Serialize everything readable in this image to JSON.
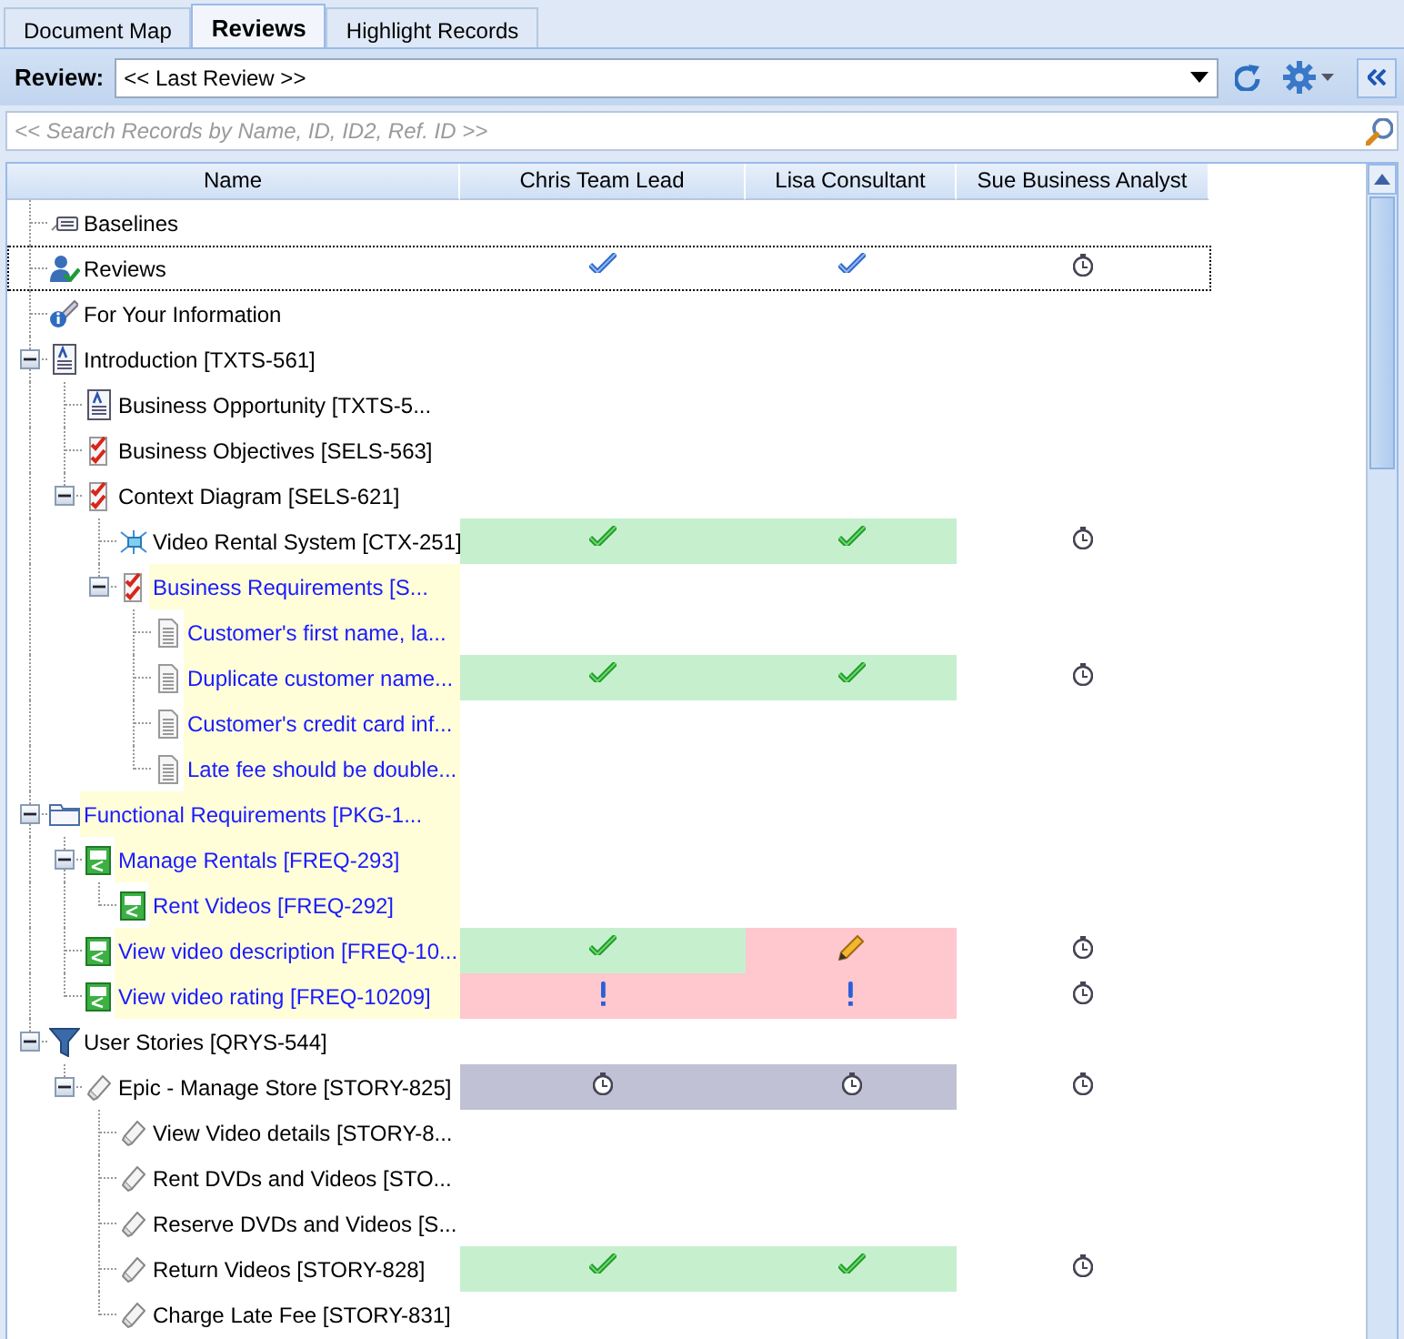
{
  "tabs": [
    {
      "label": "Document Map",
      "selected": false
    },
    {
      "label": "Reviews",
      "selected": true
    },
    {
      "label": "Highlight Records",
      "selected": false
    }
  ],
  "review": {
    "label": "Review:",
    "value": "<< Last Review >>"
  },
  "search": {
    "placeholder": "<< Search Records by Name, ID, ID2, Ref. ID >>"
  },
  "columns": [
    "Name",
    "Chris Team Lead",
    "Lisa Consultant",
    "Sue Business Analyst"
  ],
  "tree": [
    {
      "name": "Baselines",
      "kind": "baseline",
      "selected": false
    },
    {
      "name": "Reviews",
      "kind": "review",
      "selected": true,
      "reviews": [
        {
          "kind": "acknowledged"
        },
        {
          "kind": "acknowledged"
        },
        {
          "kind": "pending"
        }
      ]
    },
    {
      "name": "For Your Information",
      "kind": "info",
      "selected": false
    },
    {
      "name": "Introduction [TXTS-561]",
      "kind": "document",
      "selected": false,
      "expanded": true,
      "children": [
        {
          "name": "Business Opportunity [TXTS-5...",
          "kind": "document",
          "selected": false
        },
        {
          "name": "Business Objectives [SELS-563]",
          "kind": "checklist",
          "selected": false
        },
        {
          "name": "Context Diagram [SELS-621]",
          "kind": "checklist",
          "selected": false,
          "expanded": true,
          "children": [
            {
              "name": "Video Rental System [CTX-251]",
              "kind": "diagram",
              "selected": false,
              "reviews": [
                {
                  "kind": "approved"
                },
                {
                  "kind": "approved"
                },
                {
                  "kind": "pending"
                }
              ]
            },
            {
              "name": "Business Requirements [S...",
              "kind": "checklist",
              "selected": false,
              "link": true,
              "highlighted": true,
              "expanded": true,
              "children": [
                {
                  "name": "Customer's first name, la...",
                  "kind": "text",
                  "selected": false,
                  "link": true,
                  "highlighted": true
                },
                {
                  "name": "Duplicate customer name...",
                  "kind": "text",
                  "selected": false,
                  "link": true,
                  "highlighted": true,
                  "reviews": [
                    {
                      "kind": "approved"
                    },
                    {
                      "kind": "approved"
                    },
                    {
                      "kind": "pending"
                    }
                  ]
                },
                {
                  "name": "Customer's credit card inf...",
                  "kind": "text",
                  "selected": false,
                  "link": true,
                  "highlighted": true
                },
                {
                  "name": "Late fee should be double...",
                  "kind": "text",
                  "selected": false,
                  "link": true,
                  "highlighted": true
                }
              ]
            }
          ]
        }
      ]
    },
    {
      "name": "Functional Requirements [PKG-1...",
      "kind": "folder",
      "selected": false,
      "link": true,
      "highlighted": true,
      "expanded": true,
      "children": [
        {
          "name": "Manage Rentals [FREQ-293]",
          "kind": "feature",
          "selected": false,
          "link": true,
          "highlighted": true,
          "expanded": true,
          "children": [
            {
              "name": "Rent Videos [FREQ-292]",
              "kind": "feature",
              "selected": false,
              "link": true,
              "highlighted": true
            }
          ]
        },
        {
          "name": "View video description [FREQ-10...",
          "kind": "feature",
          "selected": false,
          "link": true,
          "highlighted": true,
          "reviews": [
            {
              "kind": "approved"
            },
            {
              "kind": "changed"
            },
            {
              "kind": "pending"
            }
          ]
        },
        {
          "name": "View video rating [FREQ-10209]",
          "kind": "feature",
          "selected": false,
          "link": true,
          "highlighted": true,
          "reviews": [
            {
              "kind": "issue"
            },
            {
              "kind": "issue"
            },
            {
              "kind": "pending"
            }
          ]
        }
      ]
    },
    {
      "name": "User Stories [QRYS-544]",
      "kind": "filter",
      "selected": false,
      "expanded": true,
      "children": [
        {
          "name": "Epic - Manage Store [STORY-825]",
          "kind": "story",
          "selected": false,
          "expanded": true,
          "reviews": [
            {
              "kind": "waiting"
            },
            {
              "kind": "waiting"
            },
            {
              "kind": "pending"
            }
          ],
          "children": [
            {
              "name": "View Video details [STORY-8...",
              "kind": "story",
              "selected": false
            },
            {
              "name": "Rent DVDs and Videos [STO...",
              "kind": "story",
              "selected": false
            },
            {
              "name": "Reserve DVDs and Videos [S...",
              "kind": "story",
              "selected": false
            },
            {
              "name": "Return Videos [STORY-828]",
              "kind": "story",
              "selected": false,
              "reviews": [
                {
                  "kind": "approved"
                },
                {
                  "kind": "approved"
                },
                {
                  "kind": "pending"
                }
              ]
            },
            {
              "name": "Charge Late Fee [STORY-831]",
              "kind": "story",
              "selected": false
            }
          ]
        }
      ]
    }
  ]
}
